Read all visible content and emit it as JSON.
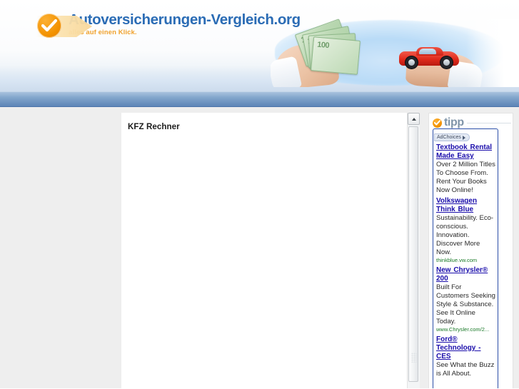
{
  "site": {
    "logo_title": "Autoversicherungen-Vergleich.org",
    "logo_tagline": "alles auf einen Klick.",
    "logo_badge_icon": "checkmark-icon",
    "accent_orange": "#f39200",
    "accent_blue": "#2b6cb5",
    "navbar_color": "#6d93c0"
  },
  "hero": {
    "banknote_value": "100",
    "alt_hand_money": "hand-holding-euro-banknotes",
    "alt_hand_car": "hand-holding-red-convertible-car"
  },
  "main": {
    "title": "KFZ Rechner"
  },
  "scrollbar": {
    "up_arrow_icon": "scroll-up-arrow-icon",
    "grip_icon": "scrollbar-grip-icon"
  },
  "ads": {
    "header_label": "tipp",
    "badge_icon": "checkmark-icon",
    "adchoices_label": "AdChoices",
    "adchoices_icon": "adchoices-triangle-icon",
    "items": [
      {
        "title": "Textbook Rental Made Easy",
        "desc": "Over 2 Million Titles To Choose From. Rent Your Books Now Online!",
        "url": ""
      },
      {
        "title": "Volkswagen Think Blue",
        "desc": "Sustainability. Eco-conscious. Innovation. Discover More Now.",
        "url": "thinkblue.vw.com"
      },
      {
        "title": "New Chrysler® 200",
        "desc": "Built For Customers Seeking Style & Substance. See It Online Today.",
        "url": "www.Chrysler.com/2..."
      },
      {
        "title": "Ford® Technology - CES",
        "desc": "See What the Buzz is All About.",
        "url": ""
      }
    ]
  }
}
